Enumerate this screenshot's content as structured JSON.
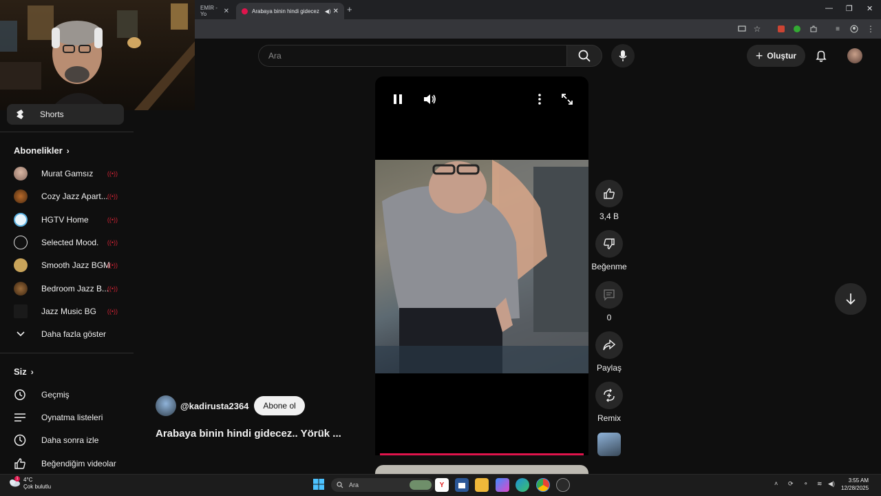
{
  "browser": {
    "tabs": [
      {
        "label": "EMİR - Yo"
      },
      {
        "label": "Arabaya binin hindi gidecez"
      }
    ],
    "active_tab_color": "#35363a"
  },
  "search": {
    "placeholder": "Ara"
  },
  "header": {
    "create_label": "Oluştur"
  },
  "sidebar": {
    "shorts_label": "Shorts",
    "subscriptions_title": "Abonelikler",
    "subscriptions": [
      {
        "name": "Murat Gamsız",
        "live": true
      },
      {
        "name": "Cozy Jazz Apart...",
        "live": true
      },
      {
        "name": "HGTV Home",
        "live": true
      },
      {
        "name": "Selected Mood.",
        "live": true
      },
      {
        "name": "Smooth Jazz BGM",
        "live": true
      },
      {
        "name": "Bedroom Jazz B...",
        "live": true
      },
      {
        "name": "Jazz Music BG",
        "live": true
      }
    ],
    "show_more_label": "Daha fazla göster",
    "you_title": "Siz",
    "you_items": [
      {
        "label": "Geçmiş",
        "icon": "history-icon"
      },
      {
        "label": "Oynatma listeleri",
        "icon": "playlist-icon"
      },
      {
        "label": "Daha sonra izle",
        "icon": "clock-icon"
      },
      {
        "label": "Beğendiğim videolar",
        "icon": "thumb-up-icon"
      }
    ],
    "live_glyph": "((•))"
  },
  "short": {
    "channel": "@kadirusta2364",
    "subscribe_label": "Abone ol",
    "title": "Arabaya binin hindi gidecez.. Yörük ...",
    "actions": {
      "like_count": "3,4 B",
      "dislike_label": "Beğenme",
      "comment_count": "0",
      "share_label": "Paylaş",
      "remix_label": "Remix"
    },
    "progress_color": "#e0144c"
  },
  "taskbar": {
    "weather_temp": "4°C",
    "weather_text": "Çok bulutlu",
    "weather_badge": "1",
    "search_placeholder": "Ara",
    "time": "3:55 AM",
    "date": "12/28/2025"
  }
}
